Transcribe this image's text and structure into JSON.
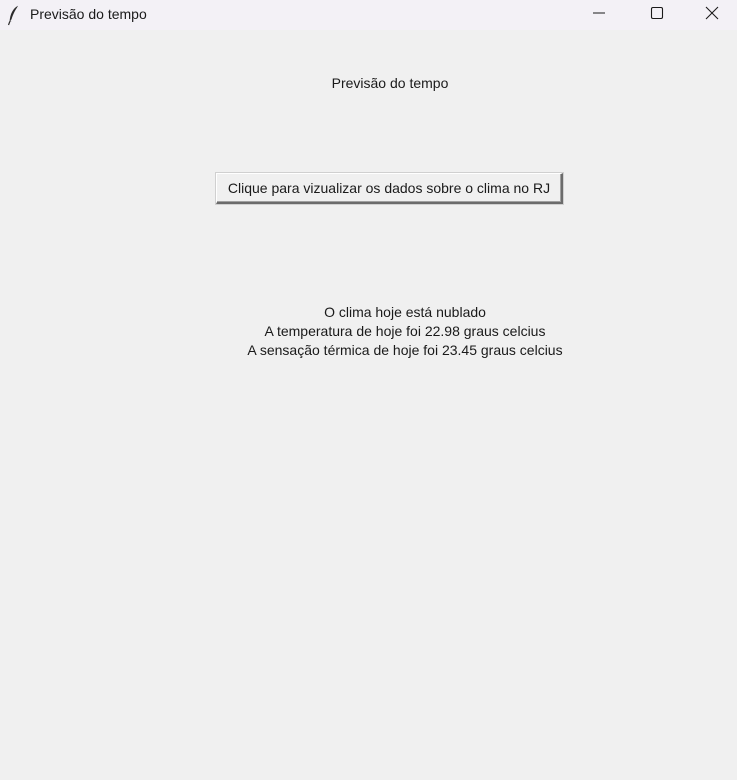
{
  "window": {
    "title": "Previsão do tempo",
    "icon": "feather-icon",
    "controls": {
      "minimize": "minimize-icon",
      "maximize": "maximize-icon",
      "close": "close-icon"
    }
  },
  "main": {
    "heading": "Previsão do tempo",
    "button_label": "Clique para vizualizar os dados sobre o clima no RJ",
    "result_lines": [
      "O clima hoje está nublado",
      "A temperatura de hoje foi 22.98 graus celcius",
      "A sensação térmica de hoje foi 23.45 graus celcius"
    ]
  },
  "colors": {
    "background": "#f0f0f0",
    "titlebar": "#f3f1f6",
    "text": "#1a1a1a"
  }
}
